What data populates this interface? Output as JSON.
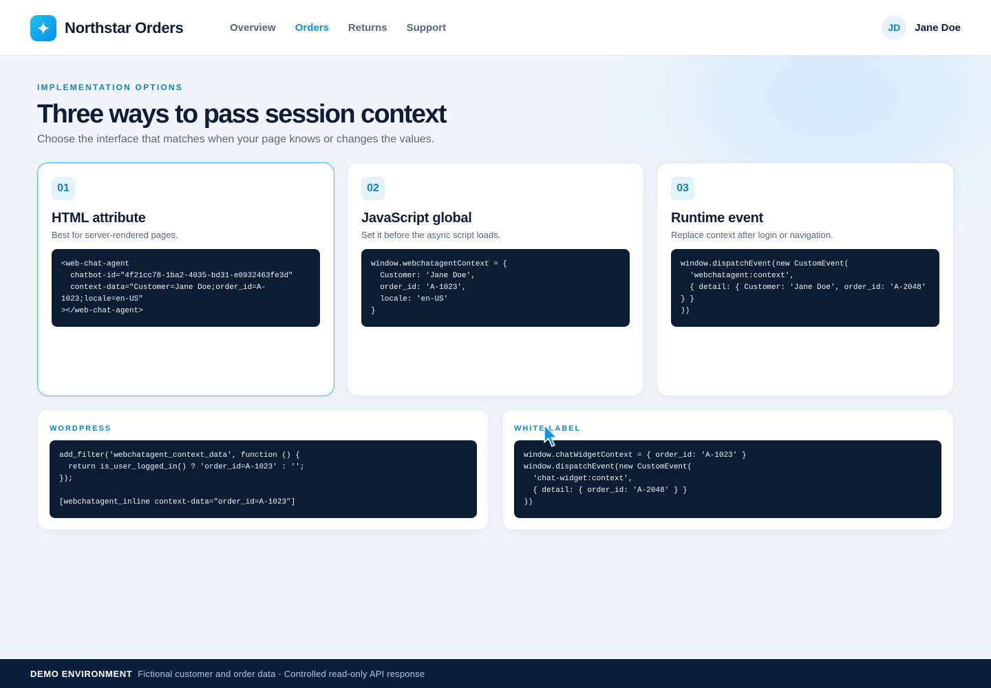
{
  "header": {
    "brand": "Northstar Orders",
    "logo_icon": "sparkle-icon",
    "nav": [
      {
        "label": "Overview",
        "active": false
      },
      {
        "label": "Orders",
        "active": true
      },
      {
        "label": "Returns",
        "active": false
      },
      {
        "label": "Support",
        "active": false
      }
    ],
    "user": {
      "initials": "JD",
      "name": "Jane Doe"
    }
  },
  "intro": {
    "eyebrow": "IMPLEMENTATION OPTIONS",
    "title": "Three ways to pass session context",
    "subtitle": "Choose the interface that matches when your page knows or changes the values."
  },
  "options": [
    {
      "number": "01",
      "title": "HTML attribute",
      "description": "Best for server-rendered pages.",
      "selected": true,
      "code": "<web-chat-agent\n  chatbot-id=\"4f21cc78-1ba2-4035-bd31-e0932463fe3d\"\n  context-data=\"Customer=Jane Doe;order_id=A-\n1023;locale=en-US\"\n></web-chat-agent>"
    },
    {
      "number": "02",
      "title": "JavaScript global",
      "description": "Set it before the async script loads.",
      "selected": false,
      "code": "window.webchatagentContext = {\n  Customer: 'Jane Doe',\n  order_id: 'A-1023',\n  locale: 'en-US'\n}"
    },
    {
      "number": "03",
      "title": "Runtime event",
      "description": "Replace context after login or navigation.",
      "selected": false,
      "code": "window.dispatchEvent(new CustomEvent(\n  'webchatagent:context',\n  { detail: { Customer: 'Jane Doe', order_id: 'A-2048'\n} }\n))"
    }
  ],
  "panels": [
    {
      "label": "WORDPRESS",
      "code": "add_filter('webchatagent_context_data', function () {\n  return is_user_logged_in() ? 'order_id=A-1023' : '';\n});\n\n[webchatagent_inline context-data=\"order_id=A-1023\"]"
    },
    {
      "label": "WHITE LABEL",
      "code": "window.chatWidgetContext = { order_id: 'A-1023' }\nwindow.dispatchEvent(new CustomEvent(\n  'chat-widget:context',\n  { detail: { order_id: 'A-2048' } }\n))"
    }
  ],
  "footer": {
    "label": "DEMO ENVIRONMENT",
    "text": "Fictional customer and order data · Controlled read-only API response"
  },
  "colors": {
    "accent": "#0b93d6",
    "code_bg": "#0b1c33",
    "footer_bg": "#0b1f3a",
    "selected_border": "#3bb6e8"
  }
}
